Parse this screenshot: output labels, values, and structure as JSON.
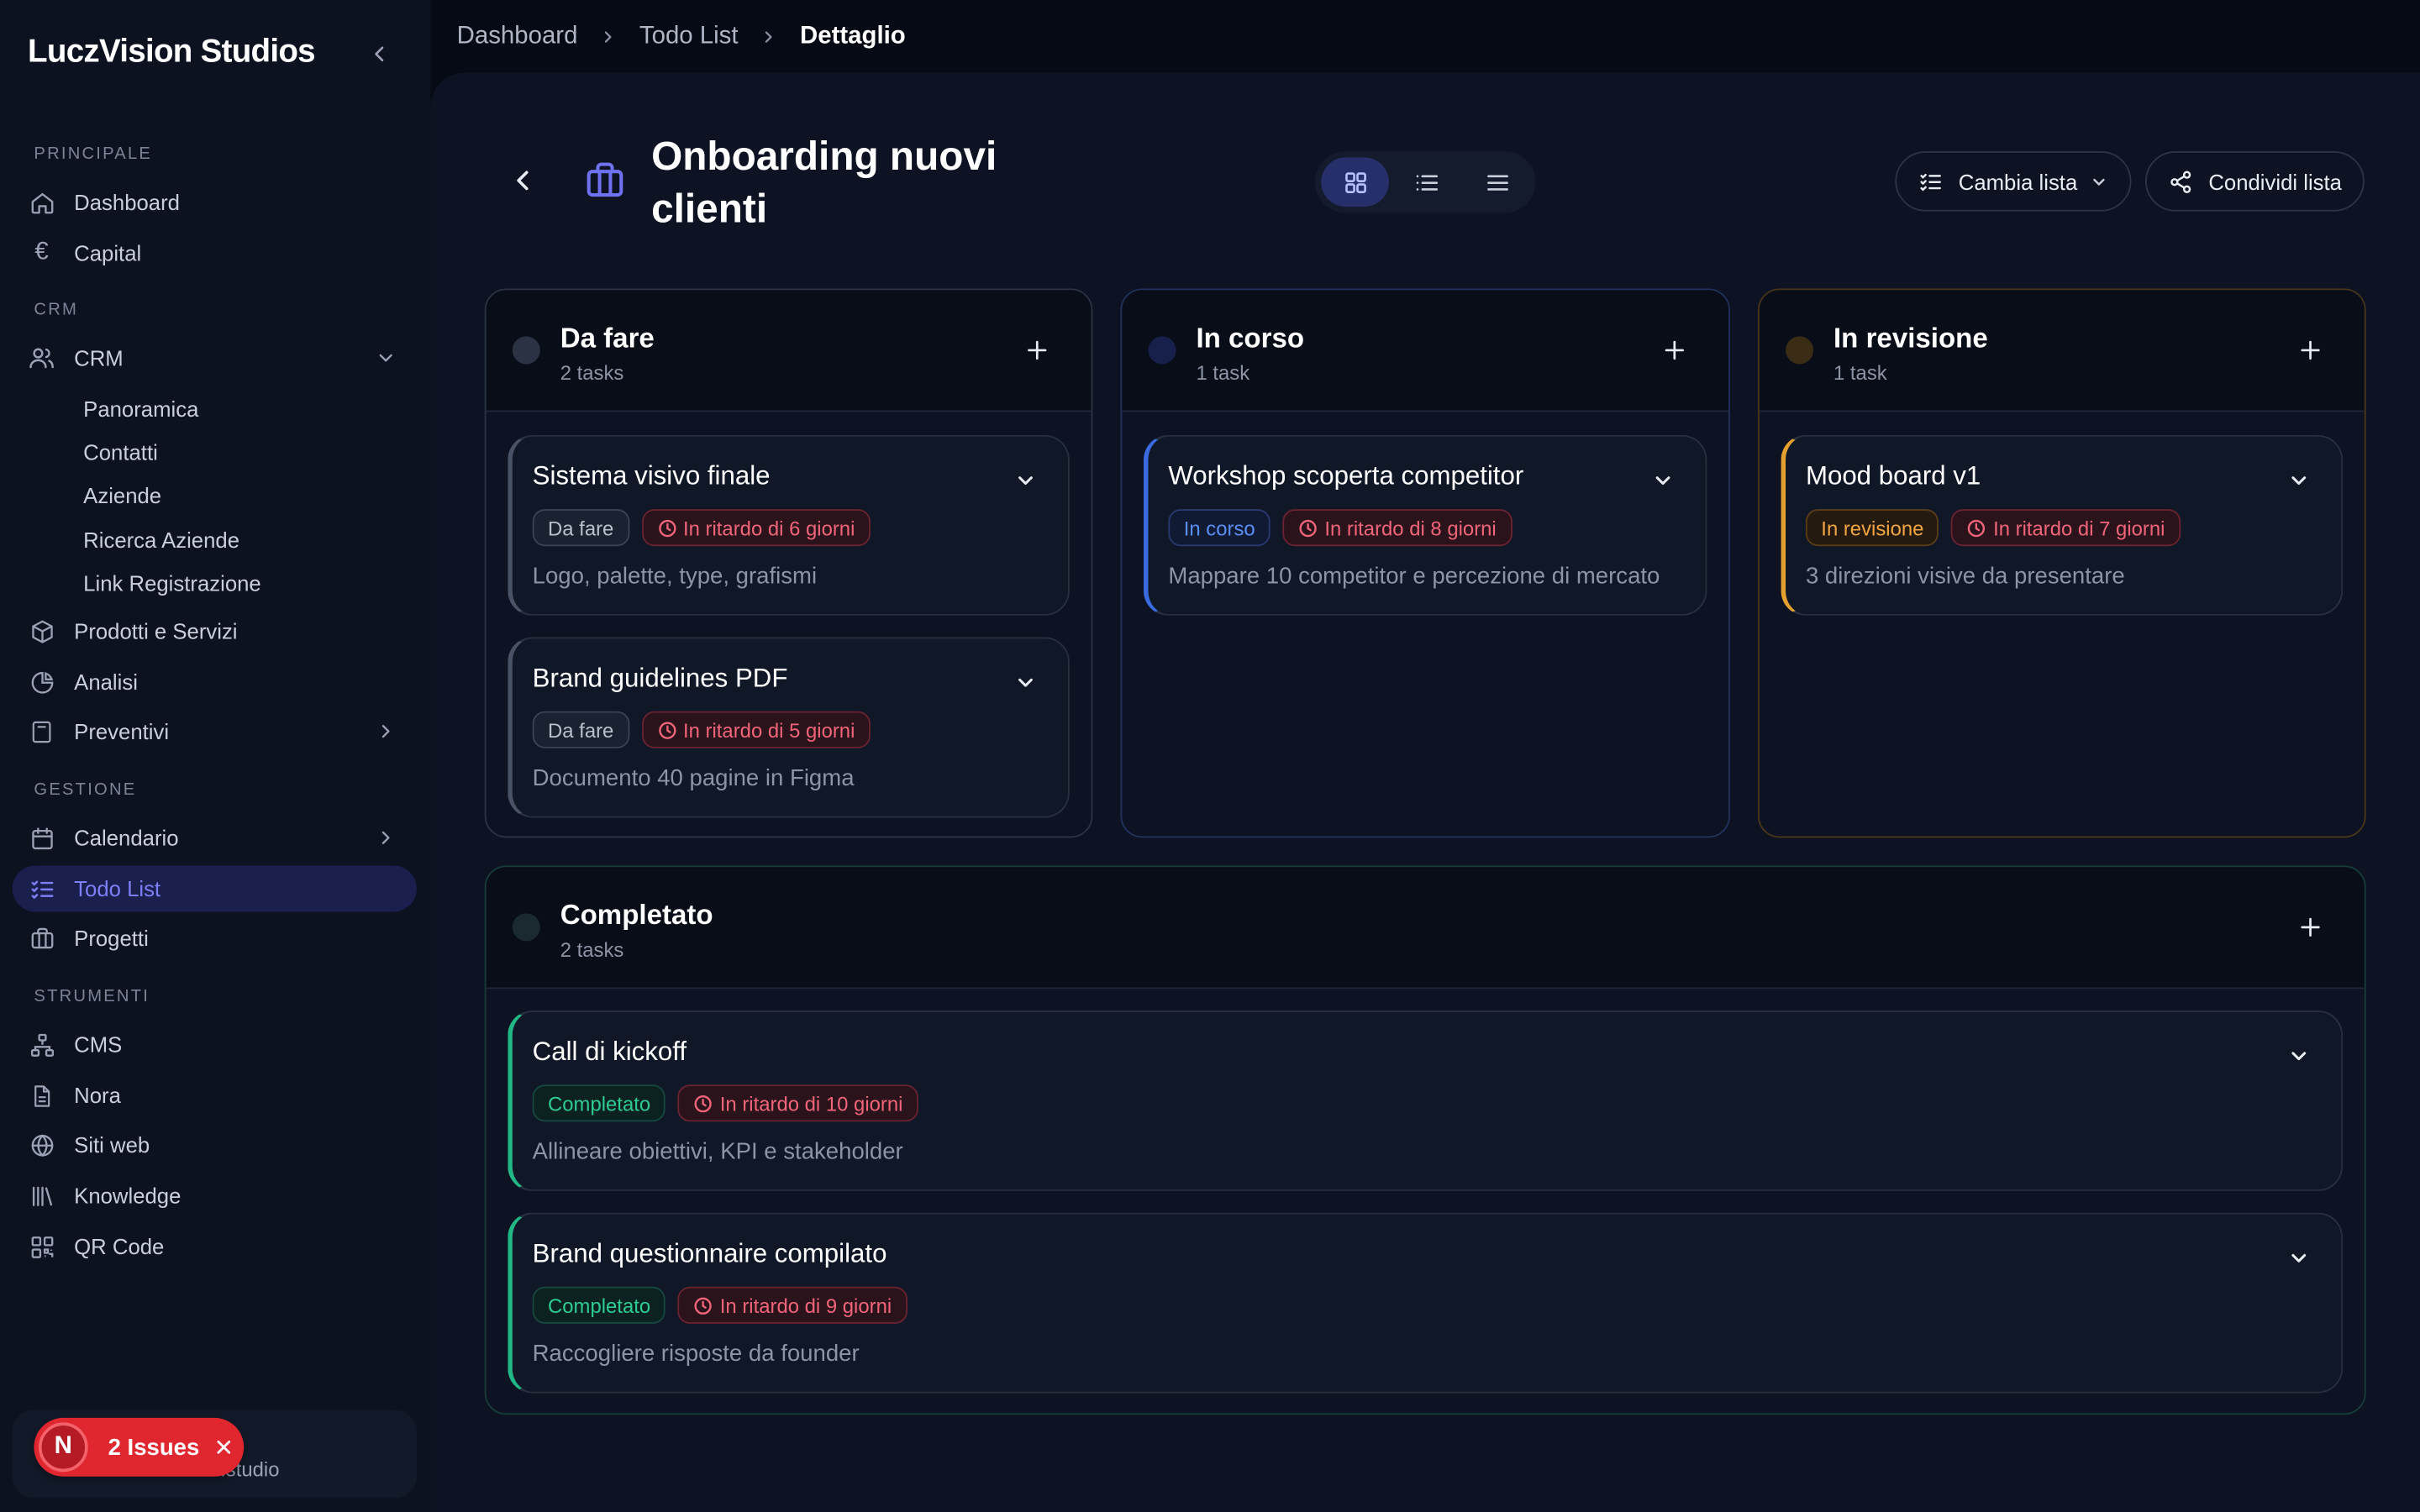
{
  "sidebar": {
    "brand": "LuczVision Studios",
    "sections": {
      "principale": "PRINCIPALE",
      "crm": "CRM",
      "gestione": "GESTIONE",
      "strumenti": "STRUMENTI"
    },
    "items": {
      "dashboard": "Dashboard",
      "capital": "Capital",
      "crm": "CRM",
      "panoramica": "Panoramica",
      "contatti": "Contatti",
      "aziende": "Aziende",
      "ricerca_aziende": "Ricerca Aziende",
      "link_registrazione": "Link Registrazione",
      "prodotti": "Prodotti e Servizi",
      "analisi": "Analisi",
      "preventivi": "Preventivi",
      "calendario": "Calendario",
      "todo": "Todo List",
      "progetti": "Progetti",
      "cms": "CMS",
      "nora": "Nora",
      "siti": "Siti web",
      "knowledge": "Knowledge",
      "qr": "QR Code"
    },
    "user_email_partial": "ision.studio",
    "issues": {
      "avatar": "N",
      "label": "2 Issues"
    }
  },
  "breadcrumb": {
    "root": "Dashboard",
    "mid": "Todo List",
    "current": "Dettaglio"
  },
  "page": {
    "title": "Onboarding nuovi clienti"
  },
  "toolbar": {
    "switch_list": "Cambia lista",
    "share_list": "Condividi lista"
  },
  "columns": {
    "todo": {
      "title": "Da fare",
      "count": "2 tasks",
      "cards": [
        {
          "title": "Sistema visivo finale",
          "status": "Da fare",
          "late": "In ritardo di 6 giorni",
          "desc": "Logo, palette, type, grafismi"
        },
        {
          "title": "Brand guidelines PDF",
          "status": "Da fare",
          "late": "In ritardo di 5 giorni",
          "desc": "Documento 40 pagine in Figma"
        }
      ]
    },
    "progress": {
      "title": "In corso",
      "count": "1 task",
      "cards": [
        {
          "title": "Workshop scoperta competitor",
          "status": "In corso",
          "late": "In ritardo di 8 giorni",
          "desc": "Mappare 10 competitor e percezione di mercato"
        }
      ]
    },
    "review": {
      "title": "In revisione",
      "count": "1 task",
      "cards": [
        {
          "title": "Mood board v1",
          "status": "In revisione",
          "late": "In ritardo di 7 giorni",
          "desc": "3 direzioni visive da presentare"
        }
      ]
    },
    "done": {
      "title": "Completato",
      "count": "2 tasks",
      "cards": [
        {
          "title": "Call di kickoff",
          "status": "Completato",
          "late": "In ritardo di 10 giorni",
          "desc": "Allineare obiettivi, KPI e stakeholder"
        },
        {
          "title": "Brand questionnaire compilato",
          "status": "Completato",
          "late": "In ritardo di 9 giorni",
          "desc": "Raccogliere risposte da founder"
        }
      ]
    }
  },
  "colors": {
    "accent": "#6e72f0",
    "todo": "#3a4356",
    "progress": "#2f56c8",
    "review": "#c98a2a",
    "done": "#1fa07a",
    "danger": "#e0262f"
  }
}
